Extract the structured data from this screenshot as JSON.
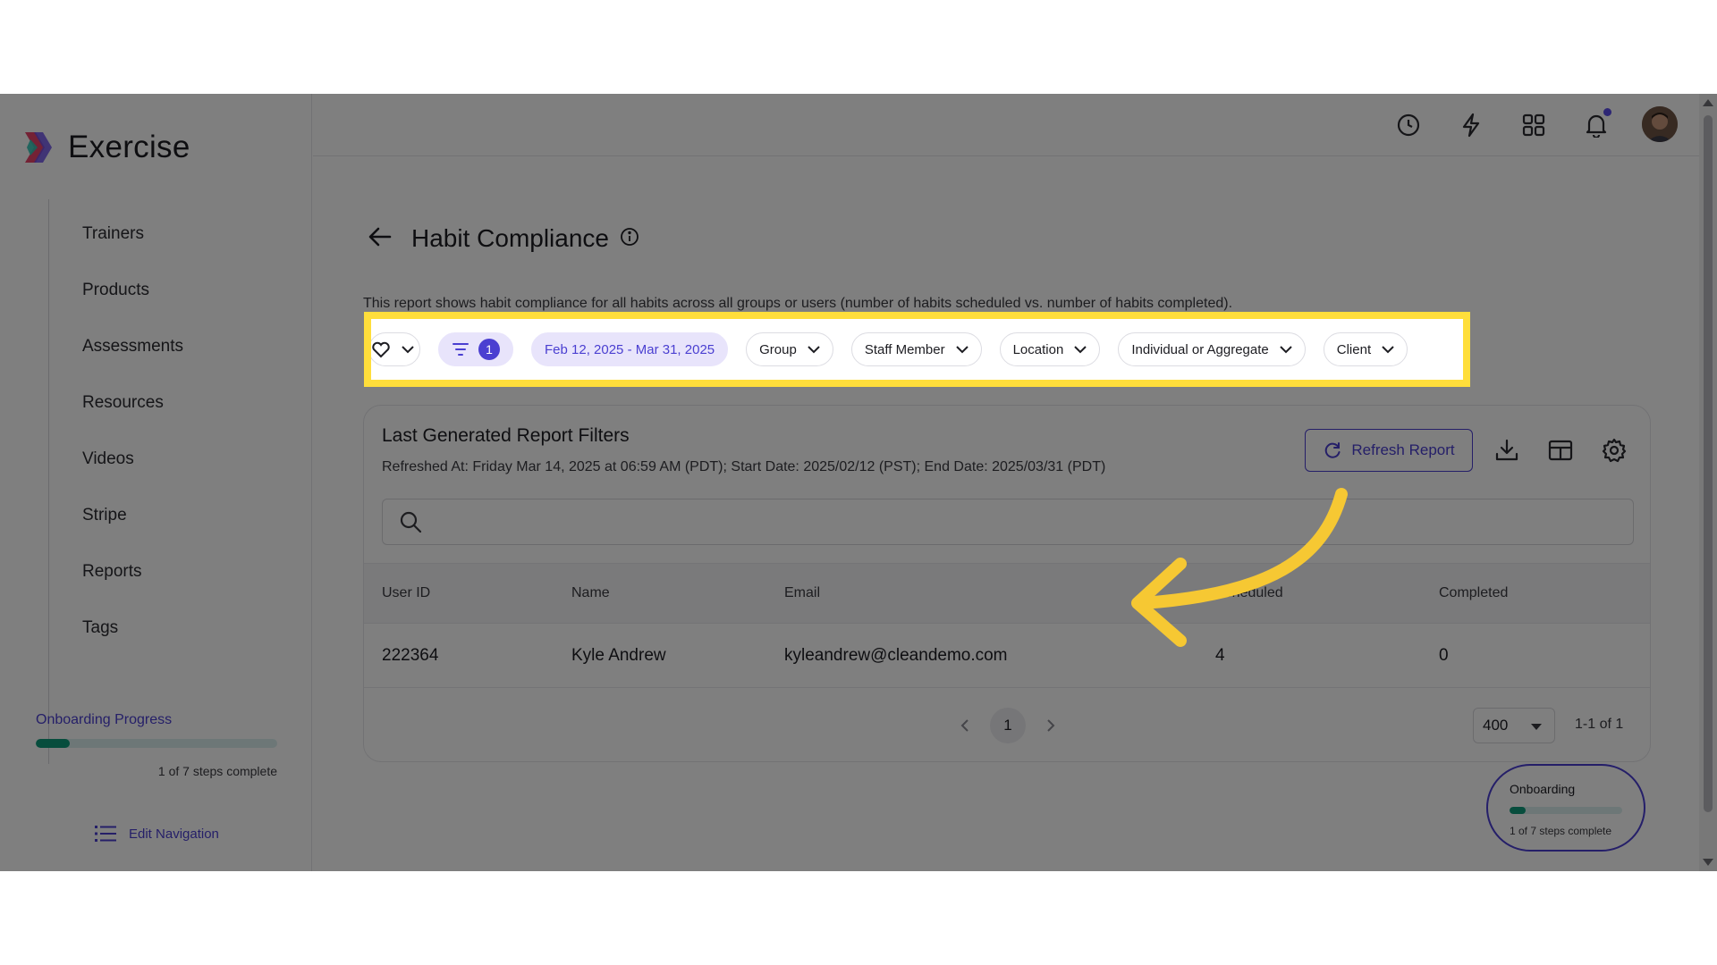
{
  "app": {
    "name": "Exercise"
  },
  "sidebar": {
    "items": [
      {
        "label": "Trainers"
      },
      {
        "label": "Products"
      },
      {
        "label": "Assessments"
      },
      {
        "label": "Resources"
      },
      {
        "label": "Videos"
      },
      {
        "label": "Stripe"
      },
      {
        "label": "Reports"
      },
      {
        "label": "Tags"
      }
    ],
    "onboarding": {
      "title": "Onboarding Progress",
      "steps_text": "1 of 7 steps complete",
      "progress": 0.14
    },
    "edit_navigation": "Edit Navigation"
  },
  "topbar": {
    "icons": [
      "clock-icon",
      "bolt-icon",
      "apps-grid-icon",
      "bell-icon"
    ]
  },
  "page": {
    "title": "Habit Compliance",
    "description": "This report shows habit compliance for all habits across all groups or users (number of habits scheduled vs. number of habits completed)."
  },
  "filters": {
    "active_count": "1",
    "date_range": "Feb 12, 2025 - Mar 31, 2025",
    "dropdowns": [
      "Group",
      "Staff Member",
      "Location",
      "Individual or Aggregate",
      "Client"
    ]
  },
  "report": {
    "title": "Last Generated Report Filters",
    "subtitle": "Refreshed At: Friday Mar 14, 2025 at 06:59 AM (PDT); Start Date: 2025/02/12 (PST); End Date: 2025/03/31 (PDT)",
    "refresh_label": "Refresh Report",
    "search_placeholder": ""
  },
  "table": {
    "columns": [
      "User ID",
      "Name",
      "Email",
      "Scheduled",
      "Completed"
    ],
    "rows": [
      [
        "222364",
        "Kyle Andrew",
        "kyleandrew@cleandemo.com",
        "4",
        "0"
      ]
    ]
  },
  "pagination": {
    "current_page": "1",
    "page_size": "400",
    "range": "1-1 of 1"
  },
  "onboarding_widget": {
    "title": "Onboarding",
    "steps_text": "1 of 7 steps complete",
    "progress": 0.14
  },
  "colors": {
    "accent": "#4a3fd1",
    "progress": "#0f9a7a",
    "highlight": "#ffde3b",
    "annotation_arrow": "#f6c833"
  }
}
